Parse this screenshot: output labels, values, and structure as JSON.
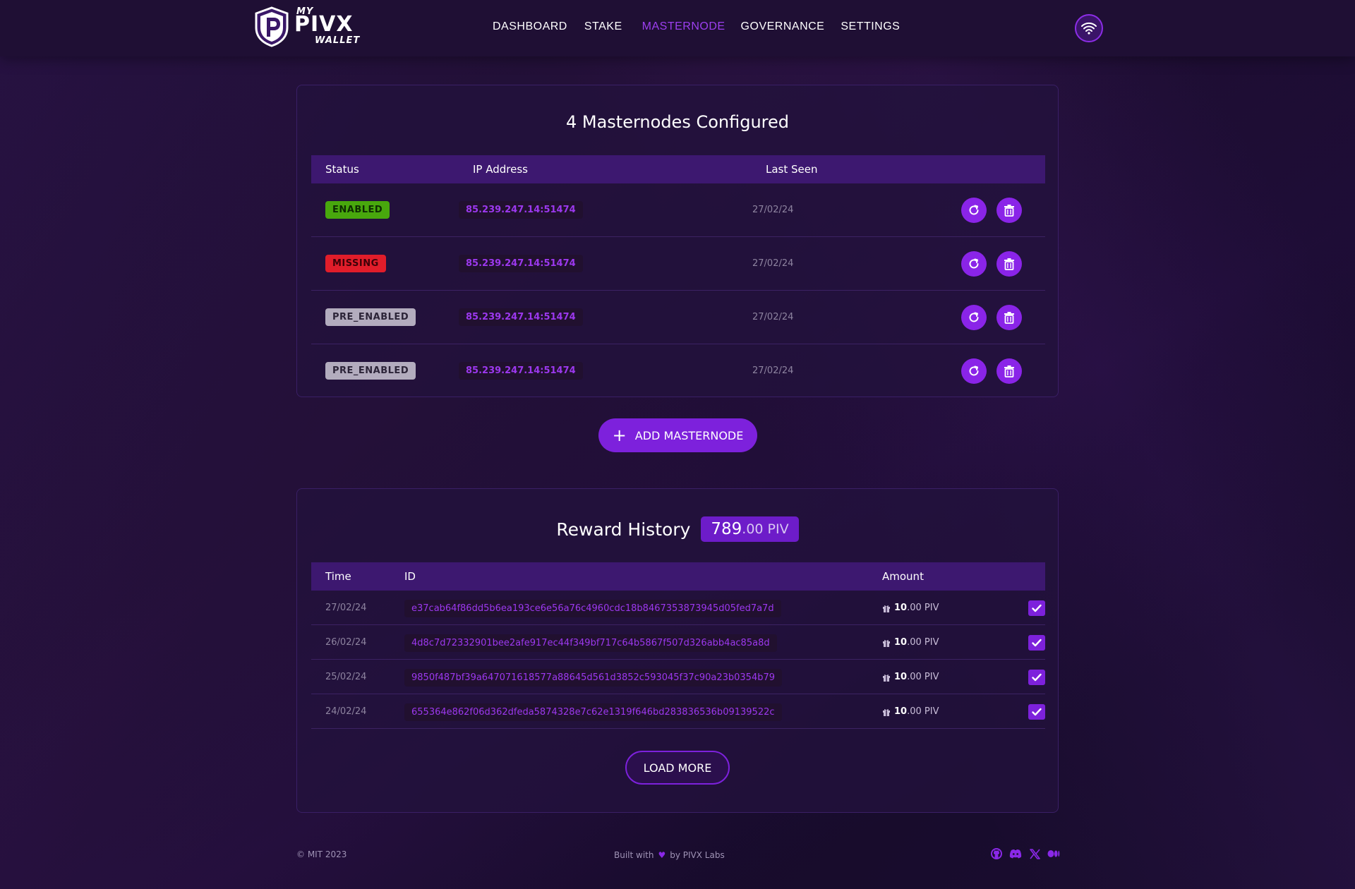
{
  "logo": {
    "my": "MY",
    "pivx": "PIVX",
    "wallet": "WALLET"
  },
  "nav": {
    "items": [
      "DASHBOARD",
      "STAKE",
      "MASTERNODE",
      "GOVERNANCE",
      "SETTINGS"
    ],
    "active": "MASTERNODE"
  },
  "network_icon": "wifi-icon",
  "masternodes": {
    "title": "4 Masternodes Configured",
    "headers": {
      "status": "Status",
      "ip": "IP Address",
      "last_seen": "Last Seen"
    },
    "rows": [
      {
        "status": "ENABLED",
        "ip": "85.239.247.14:51474",
        "last_seen": "27/02/24"
      },
      {
        "status": "MISSING",
        "ip": "85.239.247.14:51474",
        "last_seen": "27/02/24"
      },
      {
        "status": "PRE_ENABLED",
        "ip": "85.239.247.14:51474",
        "last_seen": "27/02/24"
      },
      {
        "status": "PRE_ENABLED",
        "ip": "85.239.247.14:51474",
        "last_seen": "27/02/24"
      }
    ],
    "add_button": "ADD MASTERNODE"
  },
  "rewards": {
    "title": "Reward History",
    "total_int": "789",
    "total_dec": ".00 PIV",
    "headers": {
      "time": "Time",
      "id": "ID",
      "amount": "Amount"
    },
    "rows": [
      {
        "time": "27/02/24",
        "id": "e37cab64f86dd5b6ea193ce6e56a76c4960cdc18b8467353873945d05fed7a7d",
        "amount_int": "10",
        "amount_dec": ".00 PIV"
      },
      {
        "time": "26/02/24",
        "id": "4d8c7d72332901bee2afe917ec44f349bf717c64b5867f507d326abb4ac85a8d",
        "amount_int": "10",
        "amount_dec": ".00 PIV"
      },
      {
        "time": "25/02/24",
        "id": "9850f487bf39a647071618577a88645d561d3852c593045f37c90a23b0354b79",
        "amount_int": "10",
        "amount_dec": ".00 PIV"
      },
      {
        "time": "24/02/24",
        "id": "655364e862f06d362dfeda5874328e7c62e1319f646bd283836536b09139522c",
        "amount_int": "10",
        "amount_dec": ".00 PIV"
      }
    ],
    "load_more": "LOAD MORE"
  },
  "footer": {
    "copyright": "© MIT 2023",
    "built_prefix": "Built with",
    "built_suffix": "by PIVX Labs",
    "icons": [
      "github-icon",
      "discord-icon",
      "x-icon",
      "medium-icon"
    ]
  },
  "colors": {
    "accent": "#8a24e8",
    "enabled": "#48a80d",
    "missing": "#e11d2a",
    "pre_enabled": "#b3acbe"
  }
}
